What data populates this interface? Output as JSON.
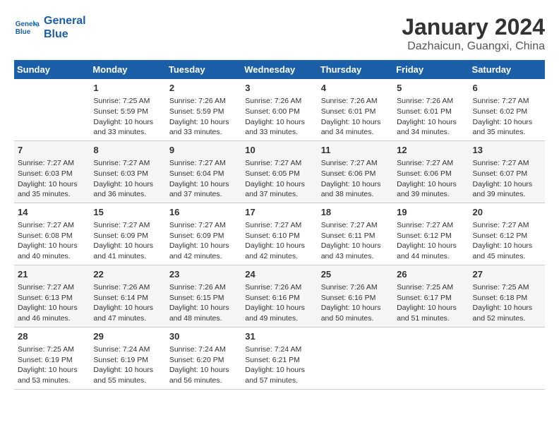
{
  "header": {
    "logo_line1": "General",
    "logo_line2": "Blue",
    "month_title": "January 2024",
    "subtitle": "Dazhaicun, Guangxi, China"
  },
  "weekdays": [
    "Sunday",
    "Monday",
    "Tuesday",
    "Wednesday",
    "Thursday",
    "Friday",
    "Saturday"
  ],
  "weeks": [
    [
      {
        "day": "",
        "info": ""
      },
      {
        "day": "1",
        "info": "Sunrise: 7:25 AM\nSunset: 5:59 PM\nDaylight: 10 hours\nand 33 minutes."
      },
      {
        "day": "2",
        "info": "Sunrise: 7:26 AM\nSunset: 5:59 PM\nDaylight: 10 hours\nand 33 minutes."
      },
      {
        "day": "3",
        "info": "Sunrise: 7:26 AM\nSunset: 6:00 PM\nDaylight: 10 hours\nand 33 minutes."
      },
      {
        "day": "4",
        "info": "Sunrise: 7:26 AM\nSunset: 6:01 PM\nDaylight: 10 hours\nand 34 minutes."
      },
      {
        "day": "5",
        "info": "Sunrise: 7:26 AM\nSunset: 6:01 PM\nDaylight: 10 hours\nand 34 minutes."
      },
      {
        "day": "6",
        "info": "Sunrise: 7:27 AM\nSunset: 6:02 PM\nDaylight: 10 hours\nand 35 minutes."
      }
    ],
    [
      {
        "day": "7",
        "info": "Sunrise: 7:27 AM\nSunset: 6:03 PM\nDaylight: 10 hours\nand 35 minutes."
      },
      {
        "day": "8",
        "info": "Sunrise: 7:27 AM\nSunset: 6:03 PM\nDaylight: 10 hours\nand 36 minutes."
      },
      {
        "day": "9",
        "info": "Sunrise: 7:27 AM\nSunset: 6:04 PM\nDaylight: 10 hours\nand 37 minutes."
      },
      {
        "day": "10",
        "info": "Sunrise: 7:27 AM\nSunset: 6:05 PM\nDaylight: 10 hours\nand 37 minutes."
      },
      {
        "day": "11",
        "info": "Sunrise: 7:27 AM\nSunset: 6:06 PM\nDaylight: 10 hours\nand 38 minutes."
      },
      {
        "day": "12",
        "info": "Sunrise: 7:27 AM\nSunset: 6:06 PM\nDaylight: 10 hours\nand 39 minutes."
      },
      {
        "day": "13",
        "info": "Sunrise: 7:27 AM\nSunset: 6:07 PM\nDaylight: 10 hours\nand 39 minutes."
      }
    ],
    [
      {
        "day": "14",
        "info": "Sunrise: 7:27 AM\nSunset: 6:08 PM\nDaylight: 10 hours\nand 40 minutes."
      },
      {
        "day": "15",
        "info": "Sunrise: 7:27 AM\nSunset: 6:09 PM\nDaylight: 10 hours\nand 41 minutes."
      },
      {
        "day": "16",
        "info": "Sunrise: 7:27 AM\nSunset: 6:09 PM\nDaylight: 10 hours\nand 42 minutes."
      },
      {
        "day": "17",
        "info": "Sunrise: 7:27 AM\nSunset: 6:10 PM\nDaylight: 10 hours\nand 42 minutes."
      },
      {
        "day": "18",
        "info": "Sunrise: 7:27 AM\nSunset: 6:11 PM\nDaylight: 10 hours\nand 43 minutes."
      },
      {
        "day": "19",
        "info": "Sunrise: 7:27 AM\nSunset: 6:12 PM\nDaylight: 10 hours\nand 44 minutes."
      },
      {
        "day": "20",
        "info": "Sunrise: 7:27 AM\nSunset: 6:12 PM\nDaylight: 10 hours\nand 45 minutes."
      }
    ],
    [
      {
        "day": "21",
        "info": "Sunrise: 7:27 AM\nSunset: 6:13 PM\nDaylight: 10 hours\nand 46 minutes."
      },
      {
        "day": "22",
        "info": "Sunrise: 7:26 AM\nSunset: 6:14 PM\nDaylight: 10 hours\nand 47 minutes."
      },
      {
        "day": "23",
        "info": "Sunrise: 7:26 AM\nSunset: 6:15 PM\nDaylight: 10 hours\nand 48 minutes."
      },
      {
        "day": "24",
        "info": "Sunrise: 7:26 AM\nSunset: 6:16 PM\nDaylight: 10 hours\nand 49 minutes."
      },
      {
        "day": "25",
        "info": "Sunrise: 7:26 AM\nSunset: 6:16 PM\nDaylight: 10 hours\nand 50 minutes."
      },
      {
        "day": "26",
        "info": "Sunrise: 7:25 AM\nSunset: 6:17 PM\nDaylight: 10 hours\nand 51 minutes."
      },
      {
        "day": "27",
        "info": "Sunrise: 7:25 AM\nSunset: 6:18 PM\nDaylight: 10 hours\nand 52 minutes."
      }
    ],
    [
      {
        "day": "28",
        "info": "Sunrise: 7:25 AM\nSunset: 6:19 PM\nDaylight: 10 hours\nand 53 minutes."
      },
      {
        "day": "29",
        "info": "Sunrise: 7:24 AM\nSunset: 6:19 PM\nDaylight: 10 hours\nand 55 minutes."
      },
      {
        "day": "30",
        "info": "Sunrise: 7:24 AM\nSunset: 6:20 PM\nDaylight: 10 hours\nand 56 minutes."
      },
      {
        "day": "31",
        "info": "Sunrise: 7:24 AM\nSunset: 6:21 PM\nDaylight: 10 hours\nand 57 minutes."
      },
      {
        "day": "",
        "info": ""
      },
      {
        "day": "",
        "info": ""
      },
      {
        "day": "",
        "info": ""
      }
    ]
  ]
}
